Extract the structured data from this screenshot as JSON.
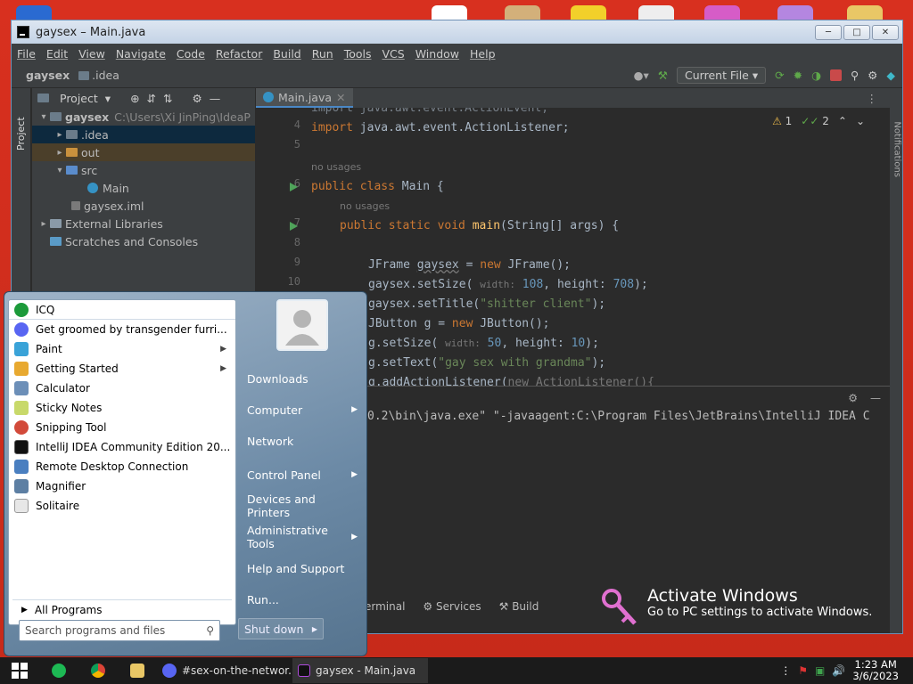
{
  "ide": {
    "title": "gaysex – Main.java",
    "menu": [
      "File",
      "Edit",
      "View",
      "Navigate",
      "Code",
      "Refactor",
      "Build",
      "Run",
      "Tools",
      "VCS",
      "Window",
      "Help"
    ],
    "breadcrumb_project": "gaysex",
    "breadcrumb_folder": ".idea",
    "run_config": "Current File",
    "left_stripe_label": "Project",
    "right_stripe_label": "Notifications",
    "project_panel": {
      "title": "Project",
      "root": "gaysex",
      "root_path": "C:\\Users\\Xi JinPing\\IdeaP",
      "items": [
        ".idea",
        "out",
        "src",
        "Main",
        "gaysex.iml",
        "External Libraries",
        "Scratches and Consoles"
      ]
    },
    "editor": {
      "tab": "Main.java",
      "warnings": "1",
      "checks": "2",
      "line_numbers": [
        "4",
        "5",
        "6",
        "7",
        "8",
        "9",
        "10"
      ],
      "hint_no_usages": "no usages",
      "lines": {
        "l_partial": "import java.awt.event.ActionEvent;",
        "l4_kw": "import",
        "l4_rest": " java.awt.event.ActionListener;",
        "l6_kw": "public class",
        "l6_rest": " Main {",
        "l7_kw": "public static void",
        "l7_fn": "main",
        "l7_rest": "(String[] args) {",
        "l9a": "JFrame ",
        "l9b": "gaysex",
        "l9c": " = ",
        "l9d": "new",
        "l9e": " JFrame();",
        "l10a": "gaysex.setSize( ",
        "l10w": "width:",
        "l10wv": " 108",
        "l10h": ", height:",
        "l10hv": " 708",
        "l10z": ");",
        "l11a": "gaysex.setTitle(",
        "l11s": "\"shitter client\"",
        "l11z": ");",
        "l12a": "JButton g = ",
        "l12b": "new",
        "l12c": " JButton();",
        "l13a": "g.setSize( ",
        "l13w": "width:",
        "l13wv": " 50",
        "l13h": ", height:",
        "l13hv": " 10",
        "l13z": ");",
        "l14a": "g.setText(",
        "l14s": "\"gay sex with grandma\"",
        "l14z": ");",
        "l15a": "g.addActionListener(",
        "l15b": "new ActionListener(){"
      }
    },
    "run_output": "0.2\\bin\\java.exe\" \"-javaagent:C:\\Program Files\\JetBrains\\IntelliJ IDEA C",
    "bottom_tabs": [
      "erminal",
      "Services",
      "Build"
    ]
  },
  "activate": {
    "title": "Activate Windows",
    "subtitle": "Go to PC settings to activate Windows."
  },
  "start_menu": {
    "left_items": [
      {
        "label": "ICQ"
      },
      {
        "label": "Get groomed by transgender furri..."
      },
      {
        "label": "Paint"
      },
      {
        "label": "Getting Started"
      },
      {
        "label": "Calculator"
      },
      {
        "label": "Sticky Notes"
      },
      {
        "label": "Snipping Tool"
      },
      {
        "label": "IntelliJ IDEA Community Edition 20..."
      },
      {
        "label": "Remote Desktop Connection"
      },
      {
        "label": "Magnifier"
      },
      {
        "label": "Solitaire"
      }
    ],
    "all_programs": "All Programs",
    "search_placeholder": "Search programs and files",
    "right_items": [
      "Downloads",
      "Computer",
      "Network",
      "Control Panel",
      "Devices and Printers",
      "Administrative Tools",
      "Help and Support",
      "Run..."
    ],
    "shutdown": "Shut down"
  },
  "taskbar": {
    "tasks": [
      "#sex-on-the-networ...",
      "gaysex - Main.java"
    ],
    "time": "1:23 AM",
    "date": "3/6/2023"
  }
}
